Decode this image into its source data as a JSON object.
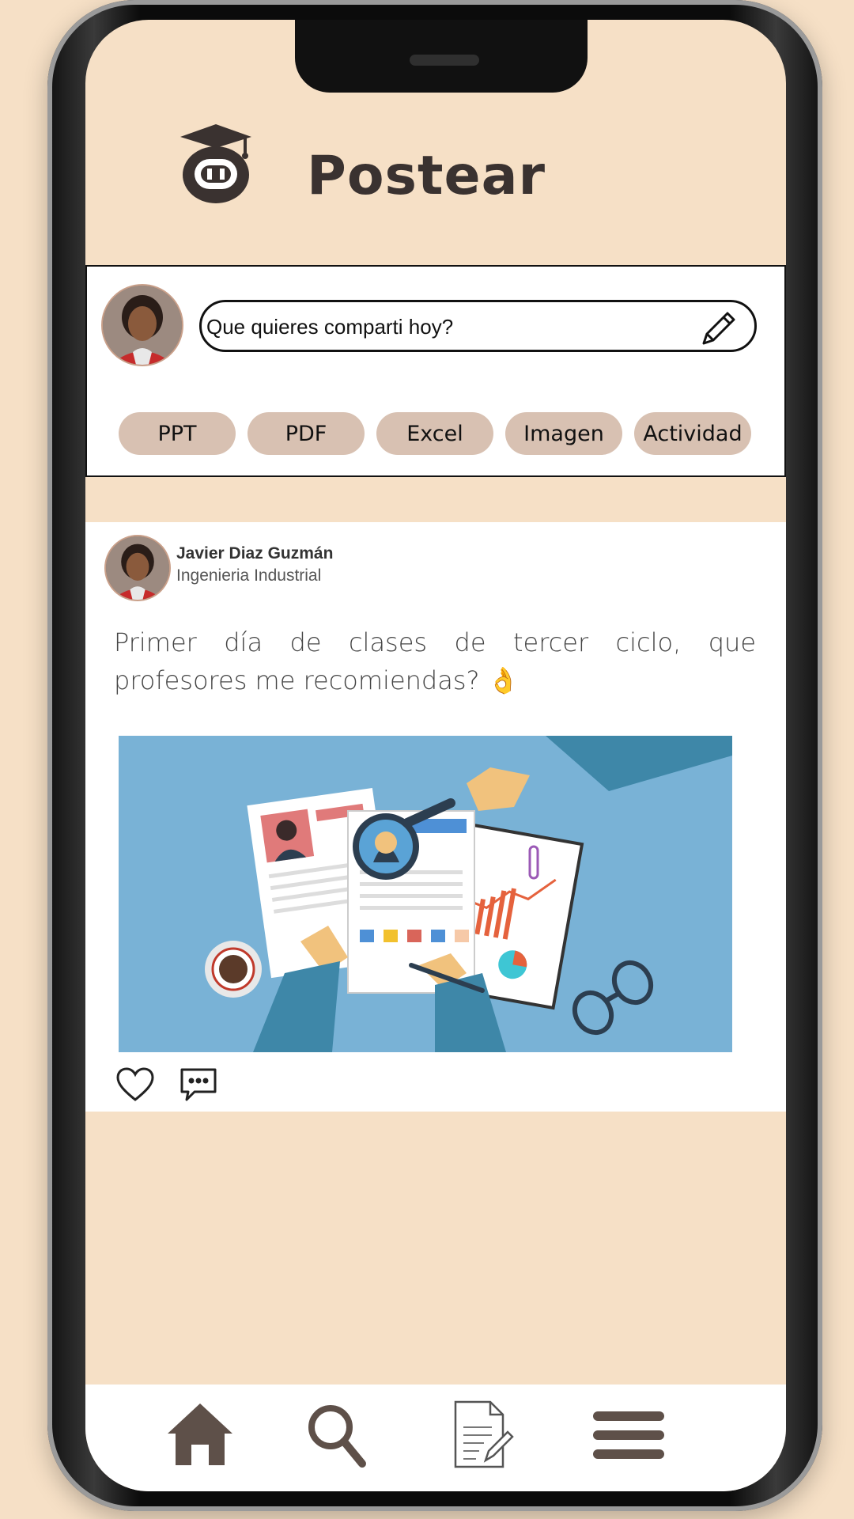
{
  "header": {
    "title": "Postear",
    "logo_icon": "owl-graduation-cap-icon"
  },
  "composer": {
    "placeholder": "Que quieres comparti hoy?",
    "attachments": [
      {
        "label": "PPT"
      },
      {
        "label": "PDF"
      },
      {
        "label": "Excel"
      },
      {
        "label": "Imagen"
      },
      {
        "label": "Actividad"
      }
    ]
  },
  "post": {
    "author_name": "Javier Diaz Guzmán",
    "author_career": "Ingenieria Industrial",
    "text": "Primer día de clases de tercer ciclo, que profesores me recomiendas? 👌",
    "image_icon": "resume-review-illustration"
  },
  "nav": {
    "items": [
      "home-icon",
      "search-icon",
      "document-edit-icon",
      "menu-icon"
    ]
  },
  "colors": {
    "background": "#F6E0C6",
    "chip": "#D8C1B2",
    "nav_icon": "#5E5049",
    "image_bg": "#79B2D6"
  }
}
